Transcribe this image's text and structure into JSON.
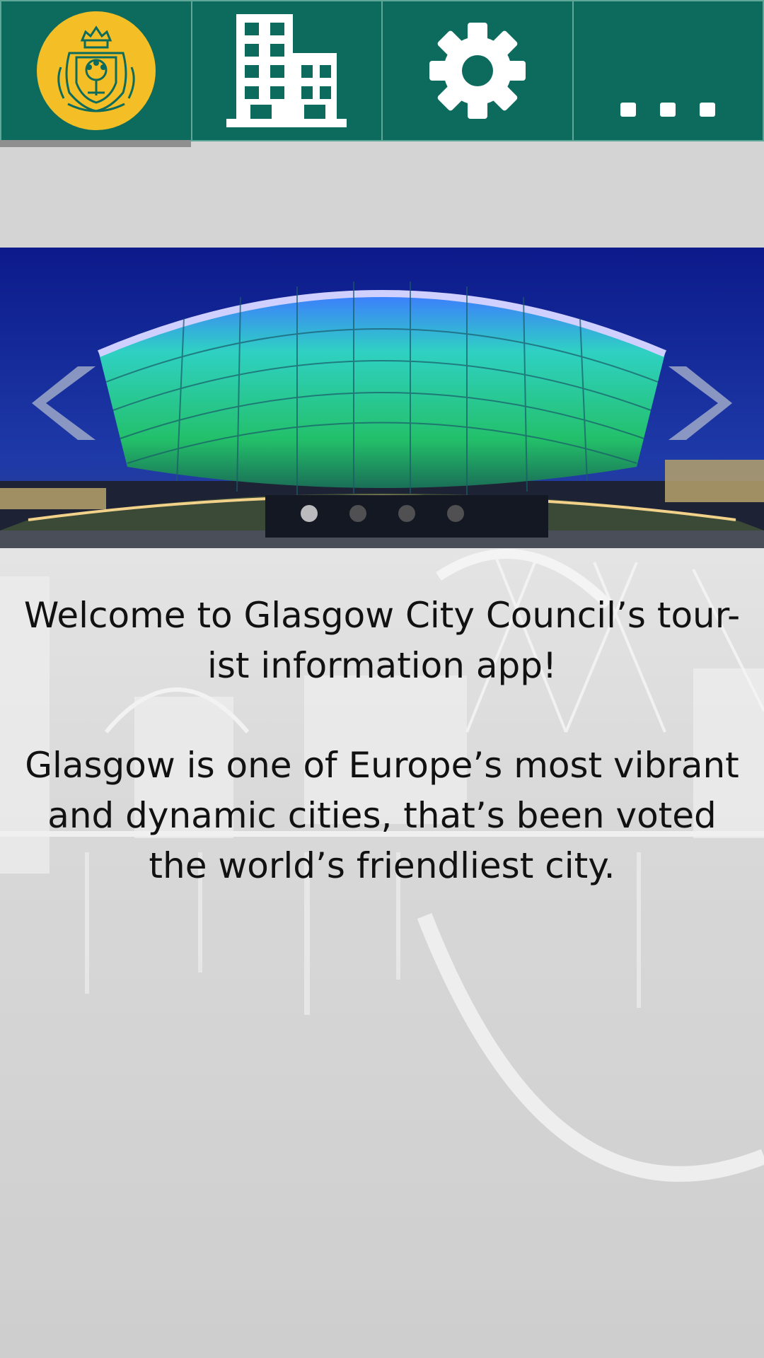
{
  "tabs": [
    {
      "id": "home",
      "icon": "council-crest-icon",
      "active": true
    },
    {
      "id": "buildings",
      "icon": "building-icon",
      "active": false
    },
    {
      "id": "settings",
      "icon": "gear-icon",
      "active": false
    },
    {
      "id": "more",
      "icon": "more-dots-icon",
      "active": false
    }
  ],
  "colors": {
    "tab_bar": "#0d6b5e",
    "tab_border": "#5fa899",
    "crest_gold": "#f4bf26",
    "active_indicator": "#8f8f8f",
    "page_background": "#d4d4d4"
  },
  "carousel": {
    "image": "illuminated-arena-at-night",
    "slide_count": 4,
    "current_slide": 1
  },
  "content": {
    "welcome": "Welcome to Glasgow City Council’s tour-ist information app!",
    "intro": "Glasgow is one of Europe’s most vibrant and dynamic cities, that’s been voted the world’s friendliest city."
  }
}
